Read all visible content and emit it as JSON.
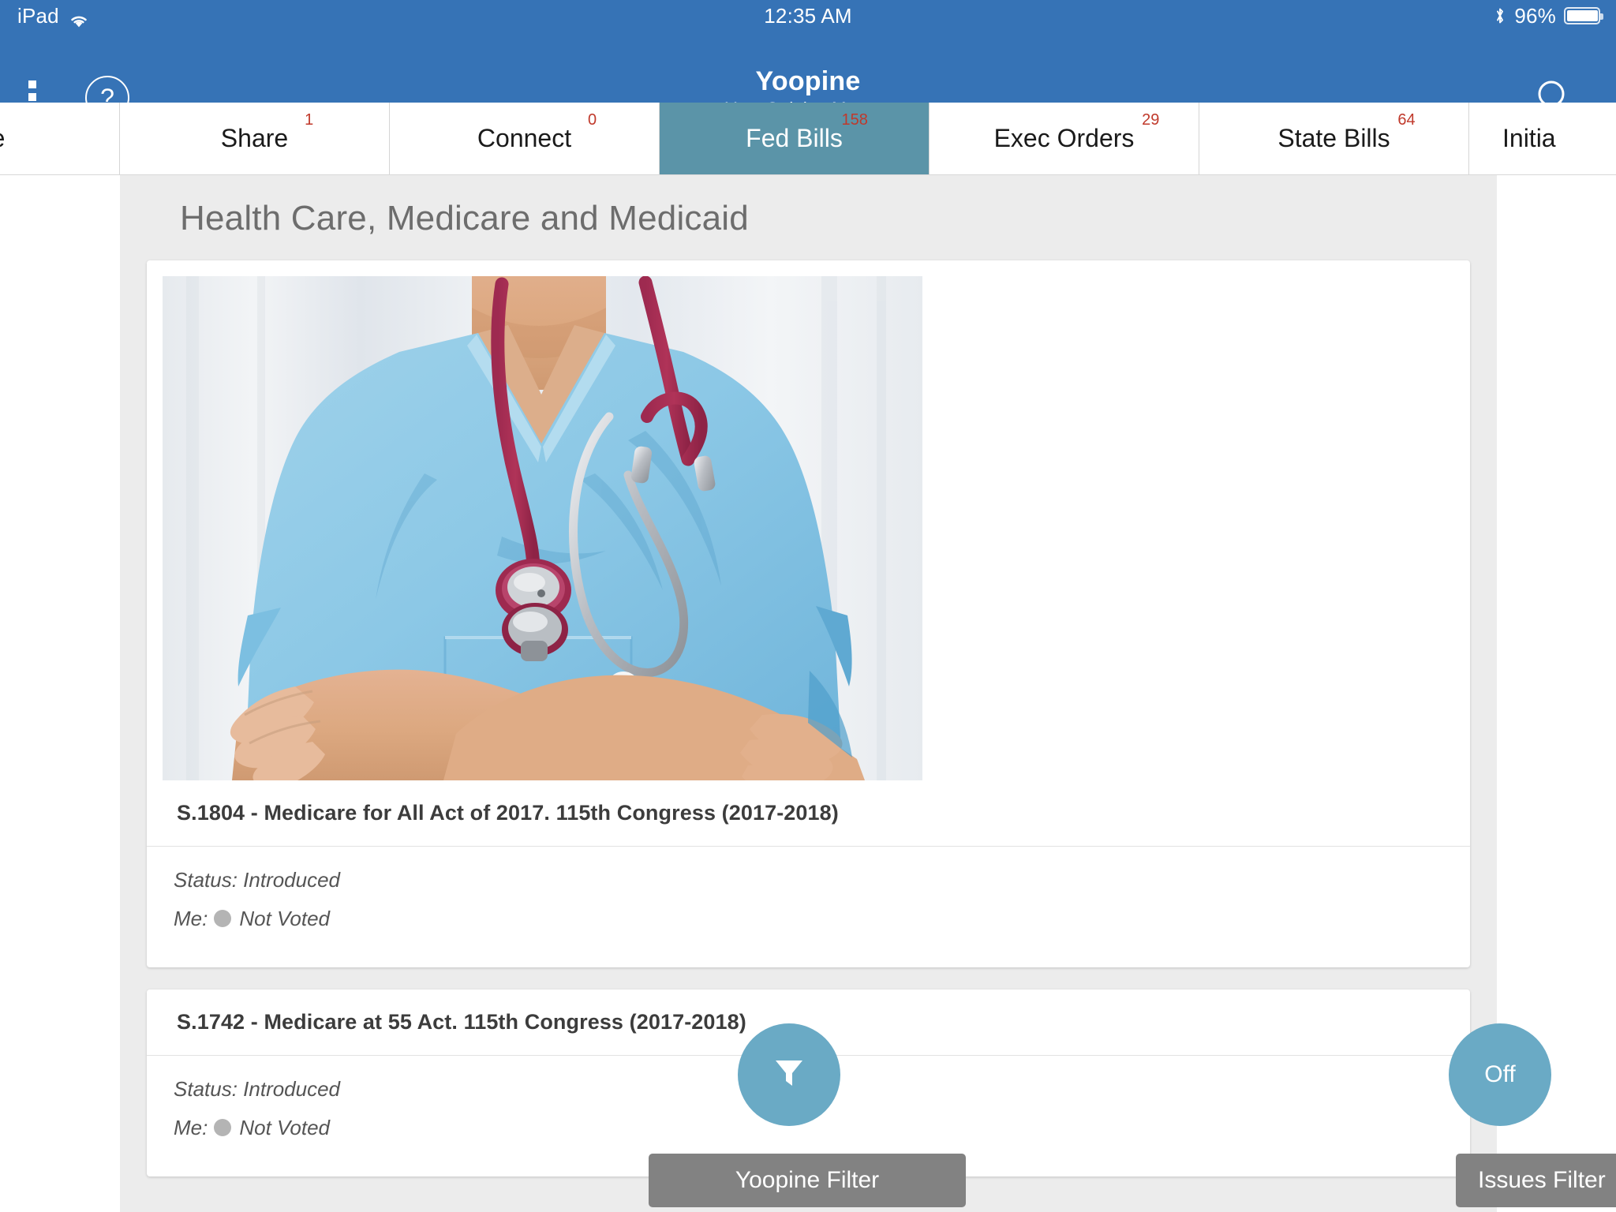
{
  "status_bar": {
    "device": "iPad",
    "wifi_icon": "wifi-icon",
    "time": "12:35 AM",
    "bluetooth_icon": "bluetooth-icon",
    "battery_percent": "96%",
    "battery_icon": "battery-icon"
  },
  "app_bar": {
    "menu_icon": "overflow-menu-icon",
    "help_icon": "help-question-icon",
    "title": "Yoopine",
    "subtitle": "Your Opinion Matters",
    "search_icon": "search-icon",
    "background_color": "#3673b6"
  },
  "tabs": {
    "active_color": "#5b94a8",
    "badge_color": "#c0392b",
    "items": [
      {
        "label": "me",
        "badge": "",
        "active": false,
        "partial": "left"
      },
      {
        "label": "Share",
        "badge": "1",
        "active": false,
        "partial": ""
      },
      {
        "label": "Connect",
        "badge": "0",
        "active": false,
        "partial": ""
      },
      {
        "label": "Fed Bills",
        "badge": "158",
        "active": true,
        "partial": ""
      },
      {
        "label": "Exec Orders",
        "badge": "29",
        "active": false,
        "partial": ""
      },
      {
        "label": "State Bills",
        "badge": "64",
        "active": false,
        "partial": ""
      },
      {
        "label": "Initia",
        "badge": "",
        "active": false,
        "partial": "right"
      }
    ]
  },
  "page": {
    "title": "Health Care, Medicare and Medicaid",
    "background_color": "#ececec"
  },
  "bills": [
    {
      "title": "S.1804 - Medicare for All Act of 2017. 115th Congress (2017-2018)",
      "status_label": "Status: Introduced",
      "me_label": "Me:",
      "vote_value": "Not Voted",
      "has_photo": true,
      "photo_alt": "nurse-in-blue-scrubs-with-stethoscope-arms-crossed"
    },
    {
      "title": "S.1742 - Medicare at 55 Act. 115th Congress (2017-2018)",
      "status_label": "Status: Introduced",
      "me_label": "Me:",
      "vote_value": "Not Voted",
      "has_photo": false,
      "photo_alt": ""
    }
  ],
  "floating": {
    "filter_fab_icon": "funnel-filter-icon",
    "yoopine_filter_label": "Yoopine Filter",
    "issues_toggle_label": "Off",
    "issues_filter_label": "Issues Filter",
    "fab_color": "#6aaac5",
    "pill_color": "#828282"
  }
}
